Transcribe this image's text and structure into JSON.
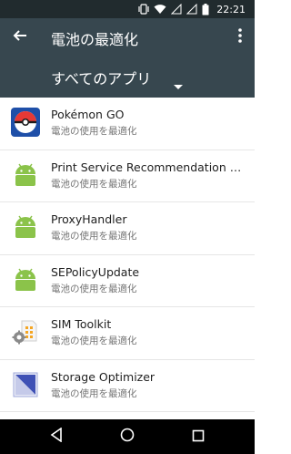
{
  "status_bar": {
    "time": "22:21",
    "icons": [
      "vibrate-icon",
      "wifi-icon",
      "signal-icon",
      "signal-2-icon",
      "battery-icon"
    ]
  },
  "toolbar": {
    "title": "電池の最適化",
    "back_icon": "arrow-back-icon",
    "overflow_icon": "more-vert-icon"
  },
  "filter": {
    "selected": "すべてのアプリ",
    "arrow_icon": "dropdown-arrow-icon"
  },
  "apps": [
    {
      "name": "Pokémon GO",
      "status": "電池の使用を最適化",
      "icon": "pokeball-icon"
    },
    {
      "name": "Print Service Recommendation Servi..",
      "status": "電池の使用を最適化",
      "icon": "android-icon"
    },
    {
      "name": "ProxyHandler",
      "status": "電池の使用を最適化",
      "icon": "android-icon"
    },
    {
      "name": "SEPolicyUpdate",
      "status": "電池の使用を最適化",
      "icon": "android-icon"
    },
    {
      "name": "SIM Toolkit",
      "status": "電池の使用を最適化",
      "icon": "sim-toolkit-icon"
    },
    {
      "name": "Storage Optimizer",
      "status": "電池の使用を最適化",
      "icon": "storage-optimizer-icon"
    }
  ],
  "nav_bar": {
    "icons": [
      "back-triangle-icon",
      "home-circle-icon",
      "recents-square-icon"
    ]
  },
  "colors": {
    "toolbar": "#37474f",
    "status_bar": "#212b2e",
    "android_green": "#8bc34a"
  }
}
